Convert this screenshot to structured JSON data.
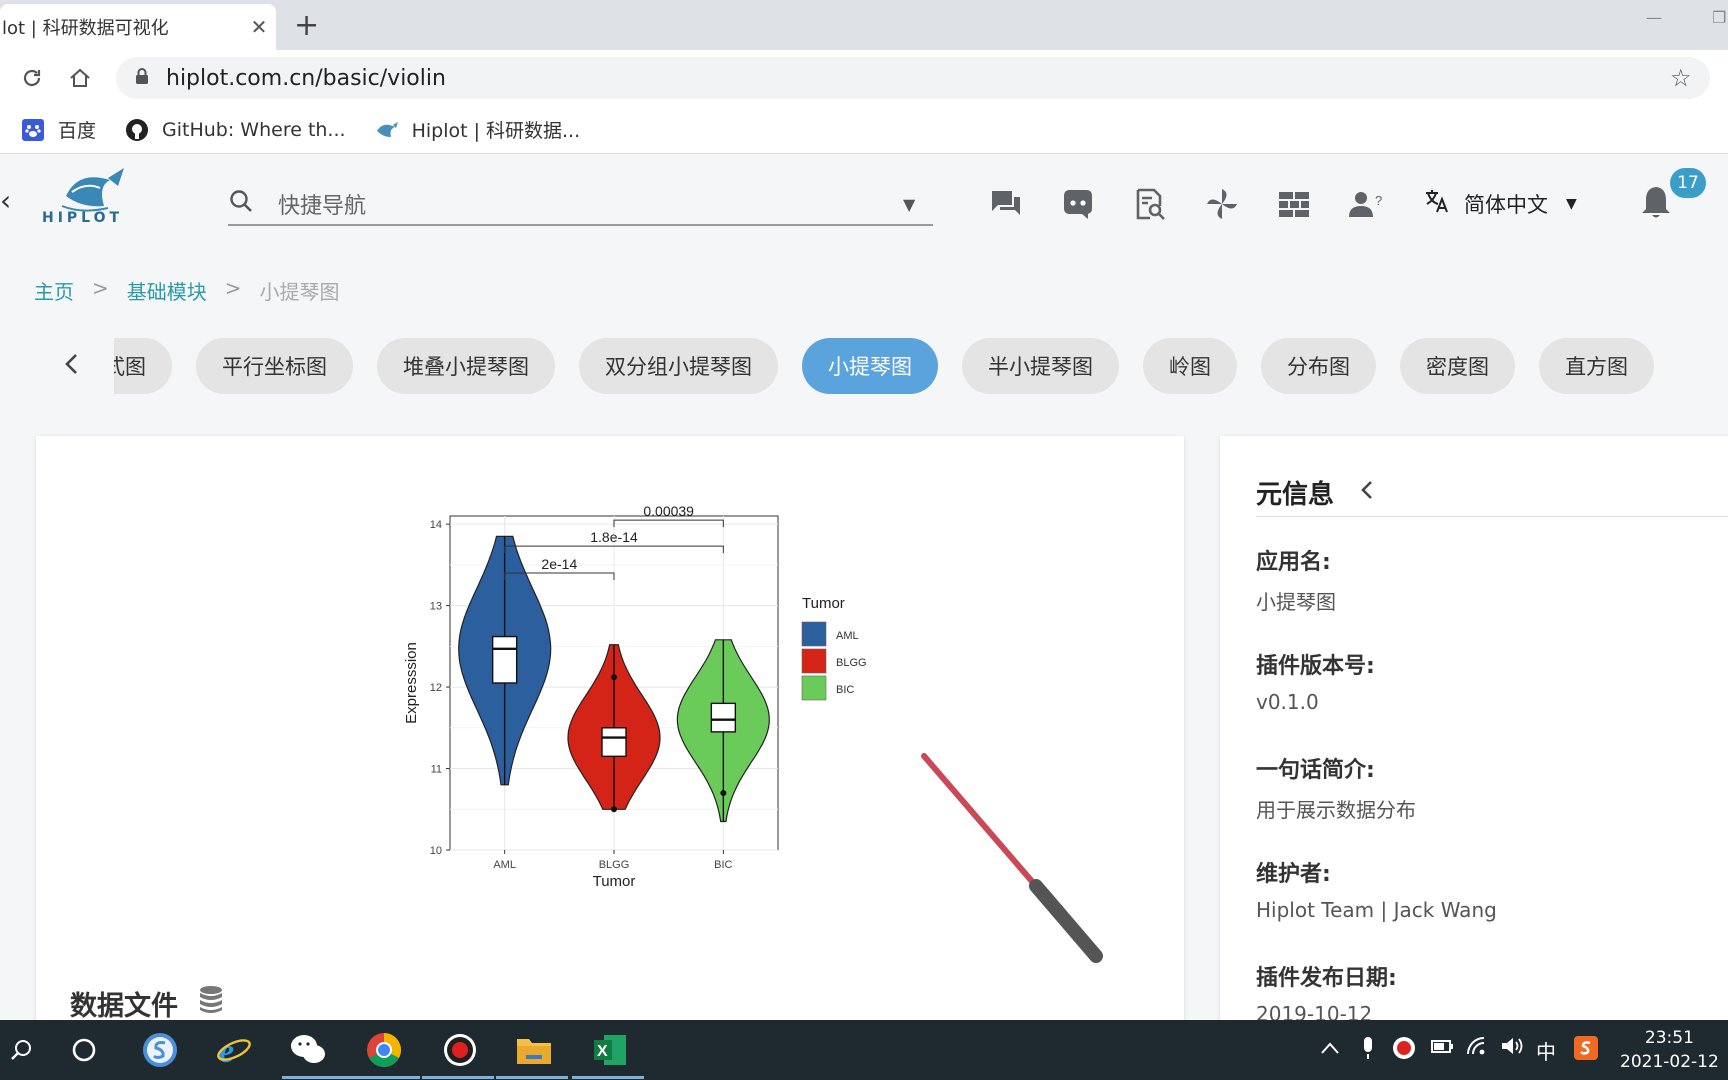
{
  "browser": {
    "tab_title": "lot | 科研数据可视化",
    "tab_close": "✕",
    "new_tab": "+",
    "url": "hiplot.com.cn/basic/violin",
    "bookmarks": [
      {
        "label": "百度",
        "icon": "baidu-paw-icon"
      },
      {
        "label": "GitHub: Where th...",
        "icon": "github-icon"
      },
      {
        "label": "Hiplot | 科研数据...",
        "icon": "hiplot-whale-icon"
      }
    ]
  },
  "header": {
    "logo_text": "HIPLOT",
    "search_placeholder": "快捷导航",
    "icons": [
      "chat-icon",
      "discord-icon",
      "search-doc-icon",
      "pinwheel-icon",
      "apps-grid-icon",
      "user-help-icon"
    ],
    "language": "简体中文",
    "notification_count": "17"
  },
  "breadcrumb": {
    "home": "主页",
    "section": "基础模块",
    "current": "小提琴图",
    "separator": ">"
  },
  "chips": [
    {
      "label": "式图",
      "active": false
    },
    {
      "label": "平行坐标图",
      "active": false
    },
    {
      "label": "堆叠小提琴图",
      "active": false
    },
    {
      "label": "双分组小提琴图",
      "active": false
    },
    {
      "label": "小提琴图",
      "active": true
    },
    {
      "label": "半小提琴图",
      "active": false
    },
    {
      "label": "岭图",
      "active": false
    },
    {
      "label": "分布图",
      "active": false
    },
    {
      "label": "密度图",
      "active": false
    },
    {
      "label": "直方图",
      "active": false
    }
  ],
  "main": {
    "data_section_title": "数据文件"
  },
  "chart_data": {
    "type": "violin",
    "xlabel": "Tumor",
    "ylabel": "Expresssion",
    "categories": [
      "AML",
      "BLGG",
      "BIC"
    ],
    "ylim": [
      10,
      14.1
    ],
    "yticks": [
      10,
      11,
      12,
      13,
      14
    ],
    "colors": [
      "#2c5f9e",
      "#d42418",
      "#6acb5a"
    ],
    "series": [
      {
        "name": "AML",
        "min": 10.8,
        "q1": 12.05,
        "median": 12.47,
        "q3": 12.62,
        "max": 13.85
      },
      {
        "name": "BLGG",
        "min": 10.5,
        "q1": 11.15,
        "median": 11.38,
        "q3": 11.5,
        "max": 12.52
      },
      {
        "name": "BIC",
        "min": 10.35,
        "q1": 11.45,
        "median": 11.6,
        "q3": 11.8,
        "max": 12.58
      }
    ],
    "comparisons": [
      {
        "from": "AML",
        "to": "BLGG",
        "label": "2e-14"
      },
      {
        "from": "AML",
        "to": "BIC",
        "label": "1.8e-14"
      },
      {
        "from": "BLGG",
        "to": "BIC",
        "label": "0.00039"
      }
    ],
    "legend": {
      "title": "Tumor",
      "items": [
        "AML",
        "BLGG",
        "BIC"
      ],
      "placement": "right"
    },
    "grid": true
  },
  "meta": {
    "title": "元信息",
    "items": [
      {
        "key": "应用名:",
        "value": "小提琴图"
      },
      {
        "key": "插件版本号:",
        "value": "v0.1.0"
      },
      {
        "key": "一句话简介:",
        "value": "用于展示数据分布"
      },
      {
        "key": "维护者:",
        "value": "Hiplot Team | Jack Wang"
      },
      {
        "key": "插件发布日期:",
        "value": "2019-10-12"
      }
    ]
  },
  "taskbar": {
    "time": "23:51",
    "date": "2021-02-12",
    "ime": "中"
  }
}
